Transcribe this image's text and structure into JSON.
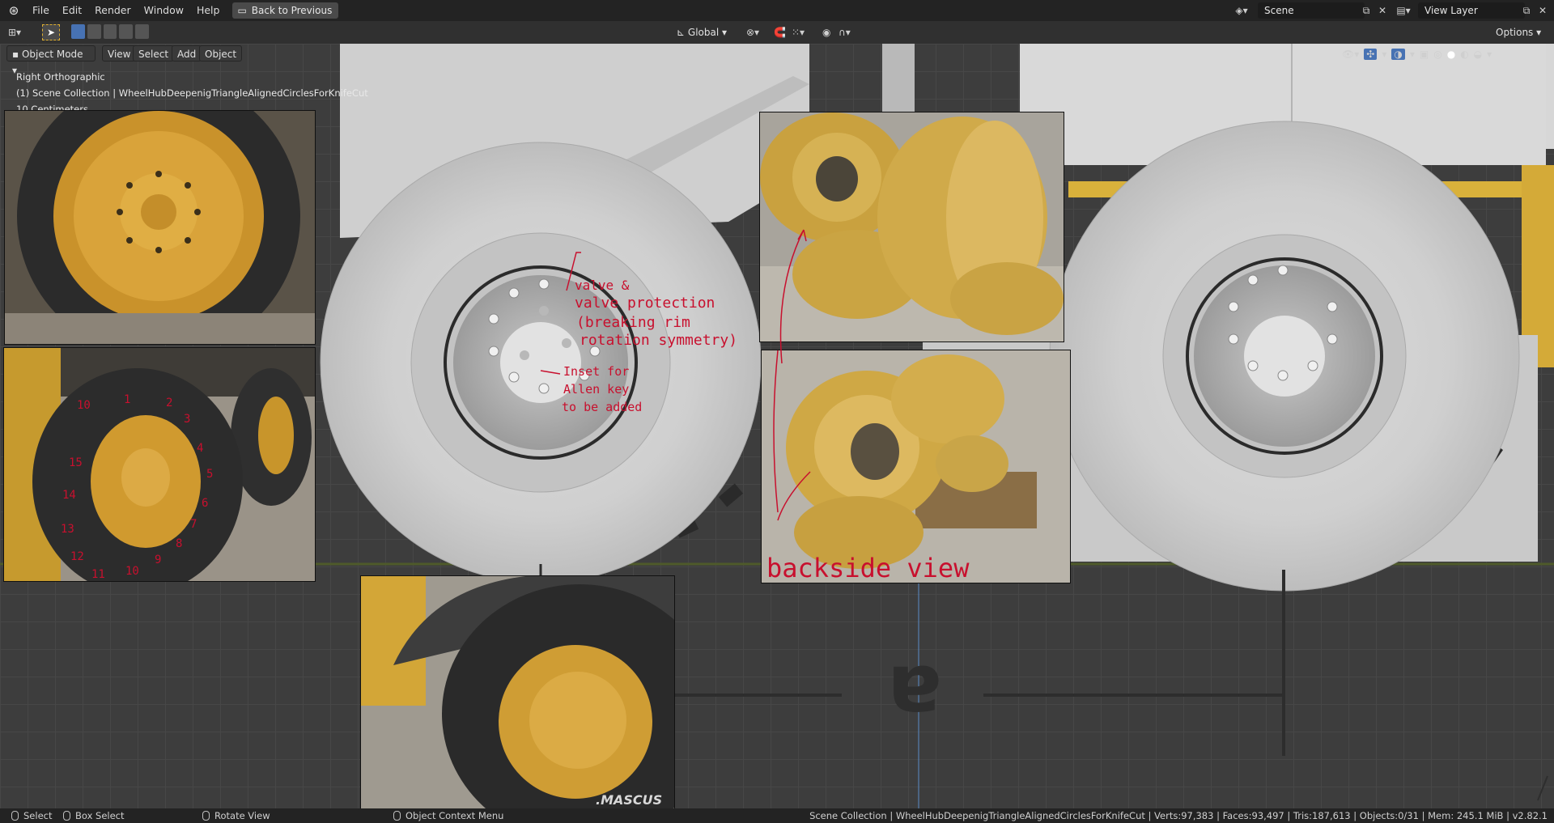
{
  "topbar": {
    "menus": [
      "File",
      "Edit",
      "Render",
      "Window",
      "Help"
    ],
    "back_button": "Back to Previous",
    "scene_label": "Scene",
    "view_layer_label": "View Layer"
  },
  "header2": {
    "orientation": "Global",
    "options": "Options"
  },
  "header3": {
    "mode": "Object Mode",
    "view": "View",
    "select": "Select",
    "add": "Add",
    "object": "Object"
  },
  "viewport": {
    "view_name": "Right Orthographic",
    "collection_info": "(1) Scene Collection | WheelHubDeepenigTriangleAlignedCirclesForKnifeCut",
    "scale": "10 Centimeters",
    "big_letter": "a"
  },
  "annotations": {
    "valve_line1": "valve &",
    "valve_line2": "valve protection",
    "valve_line3": "(breaking rim",
    "valve_line4": "rotation symmetry)",
    "inset_line1": "Inset for",
    "inset_line2": "Allen key",
    "inset_line3": "to be added",
    "backside": "backside view",
    "numbers": [
      "10",
      "1",
      "2",
      "3",
      "4",
      "5",
      "6",
      "7",
      "8",
      "9",
      "10",
      "11",
      "12",
      "13",
      "14",
      "15"
    ],
    "tire_brand": ".MASCUS"
  },
  "statusbar": {
    "select": "Select",
    "box_select": "Box Select",
    "rotate_view": "Rotate View",
    "context_menu": "Object Context Menu",
    "stats": "Scene Collection | WheelHubDeepenigTriangleAlignedCirclesForKnifeCut | Verts:97,383 | Faces:93,497 | Tris:187,613 | Objects:0/31 | Mem: 245.1 MiB | v2.82.1"
  },
  "colors": {
    "annotation_red": "#c8102e",
    "rim_yellow": "#d9a83a",
    "tire_light": "#d2d2d2"
  }
}
